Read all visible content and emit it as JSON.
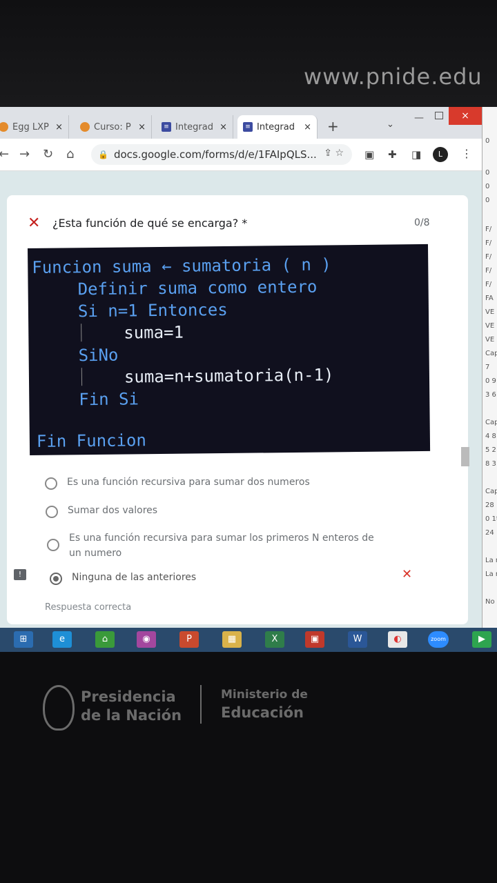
{
  "bezel": {
    "url": "www.pnide.edu"
  },
  "tabs": [
    {
      "label": "Egg LXP",
      "icon": "egg-icon"
    },
    {
      "label": "Curso: P",
      "icon": "moodle-icon"
    },
    {
      "label": "Integrad",
      "icon": "forms-icon"
    },
    {
      "label": "Integrad",
      "icon": "forms-icon",
      "active": true
    }
  ],
  "tab_close": "×",
  "new_tab": "+",
  "window": {
    "close": "×"
  },
  "address_bar": {
    "url": "docs.google.com/forms/d/e/1FAIpQLS..."
  },
  "profile": {
    "initial": "L"
  },
  "question": {
    "title": "¿Esta función de qué se encarga? *",
    "score": "0/8",
    "code_lines": [
      "Funcion suma ← sumatoria ( n )",
      "Definir suma como entero",
      "Si n=1 Entonces",
      "suma=1",
      "SiNo",
      "suma=n+sumatoria(n-1)",
      "Fin Si",
      "Fin Funcion"
    ],
    "options": [
      {
        "label": "Es una función recursiva para sumar dos numeros",
        "selected": false
      },
      {
        "label": "Sumar dos valores",
        "selected": false
      },
      {
        "label": "Es una función recursiva para sumar los primeros N enteros de un numero",
        "selected": false
      },
      {
        "label": "Ninguna de las anteriores",
        "selected": true
      }
    ],
    "feedback": "Respuesta correcta"
  },
  "sheet_cells": [
    "0",
    "0",
    "0",
    "0",
    "F/",
    "F/",
    "F/",
    "F/",
    "F/",
    "FA",
    "VE",
    "VE",
    "VE",
    "Cap",
    "7",
    "0 9",
    "3 6",
    "Cap",
    "4 8",
    "5 2",
    "8 3",
    "Cap",
    "28",
    "0 1t",
    "24",
    "La m",
    "La m",
    "No"
  ],
  "taskbar": [
    "windows-start",
    "internet-explorer",
    "store",
    "camera",
    "powerpoint",
    "file-explorer",
    "excel",
    "app",
    "word",
    "chrome",
    "zoom",
    "app-green"
  ],
  "taskbar_labels": {
    "zoom": "zoom",
    "word": "W",
    "excel": "X",
    "powerpoint": "P"
  },
  "footer": {
    "left_line1": "Presidencia",
    "left_line2": "de la Nación",
    "right_line1": "Ministerio de",
    "right_line2": "Educación"
  },
  "colors": {
    "error": "#c5221f",
    "code_keyword": "#5aa0f0",
    "taskbar": "#2a4a6c"
  }
}
